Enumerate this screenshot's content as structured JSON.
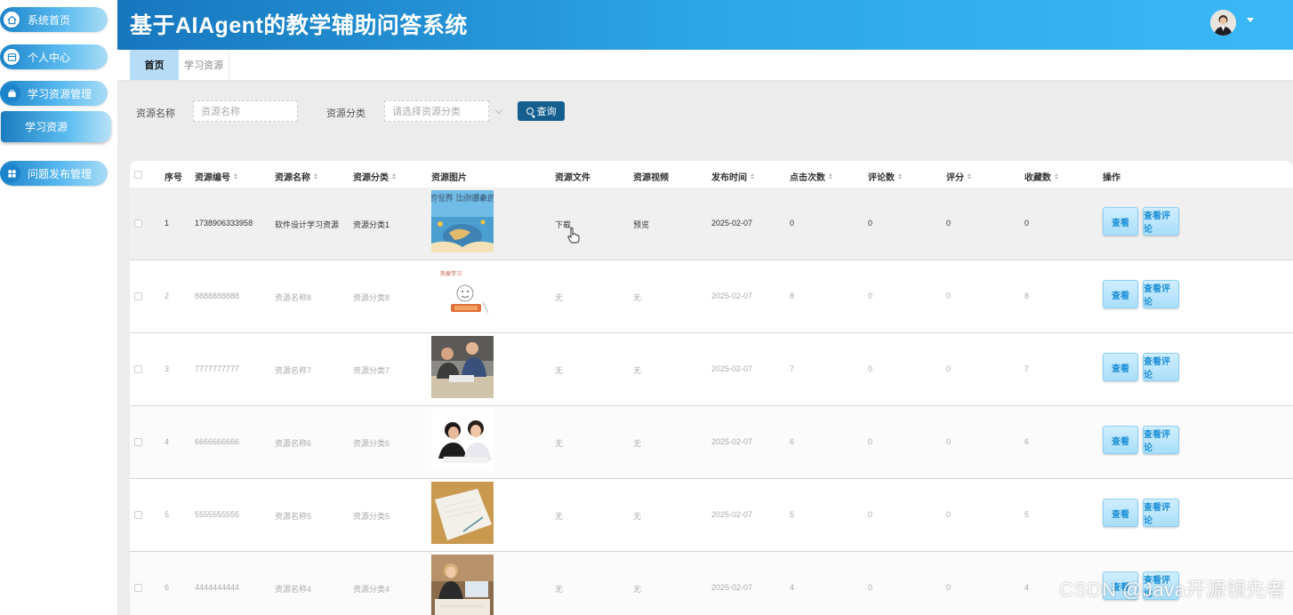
{
  "header": {
    "title": "基于AIAgent的教学辅助问答系统"
  },
  "sidebar": {
    "items": [
      {
        "label": "系统首页",
        "icon": "home-icon"
      },
      {
        "label": "个人中心",
        "icon": "card-icon"
      },
      {
        "label": "学习资源管理",
        "icon": "briefcase-icon"
      },
      {
        "label": "问题发布管理",
        "icon": "grid-icon"
      }
    ],
    "sub_items": [
      {
        "label": "学习资源"
      }
    ]
  },
  "tabs": [
    {
      "label": "首页",
      "active": true
    },
    {
      "label": "学习资源",
      "active": false
    }
  ],
  "search": {
    "name_label": "资源名称",
    "name_placeholder": "资源名称",
    "category_label": "资源分类",
    "category_placeholder": "请选择资源分类",
    "query_button": "查询"
  },
  "table": {
    "headers": [
      "序号",
      "资源编号",
      "资源名称",
      "资源分类",
      "资源图片",
      "资源文件",
      "资源视频",
      "发布时间",
      "点击次数",
      "评论数",
      "评分",
      "收藏数",
      "操作"
    ],
    "rows": [
      {
        "index": "1",
        "code": "1738906333958",
        "name": "软件设计学习资源",
        "category": "资源分类1",
        "file": "下载",
        "video": "预览",
        "date": "2025-02-07",
        "clicks": "0",
        "comments": "0",
        "rating": "0",
        "favorites": "0",
        "view": "查看",
        "comment_btn": "查看评论",
        "image_text": "节国的世界 比你想象的更大"
      },
      {
        "index": "2",
        "code": "8888888888",
        "name": "资源名称8",
        "category": "资源分类8",
        "file": "无",
        "video": "无",
        "date": "2025-02-07",
        "clicks": "8",
        "comments": "0",
        "rating": "0",
        "favorites": "8",
        "view": "查看",
        "comment_btn": "查看评论",
        "image_text": "热爱学习"
      },
      {
        "index": "3",
        "code": "7777777777",
        "name": "资源名称7",
        "category": "资源分类7",
        "file": "无",
        "video": "无",
        "date": "2025-02-07",
        "clicks": "7",
        "comments": "0",
        "rating": "0",
        "favorites": "7",
        "view": "查看",
        "comment_btn": "查看评论"
      },
      {
        "index": "4",
        "code": "6666666666",
        "name": "资源名称6",
        "category": "资源分类6",
        "file": "无",
        "video": "无",
        "date": "2025-02-07",
        "clicks": "6",
        "comments": "0",
        "rating": "0",
        "favorites": "6",
        "view": "查看",
        "comment_btn": "查看评论"
      },
      {
        "index": "5",
        "code": "5555555555",
        "name": "资源名称5",
        "category": "资源分类5",
        "file": "无",
        "video": "无",
        "date": "2025-02-07",
        "clicks": "5",
        "comments": "0",
        "rating": "0",
        "favorites": "5",
        "view": "查看",
        "comment_btn": "查看评论"
      },
      {
        "index": "6",
        "code": "4444444444",
        "name": "资源名称4",
        "category": "资源分类4",
        "file": "无",
        "video": "无",
        "date": "2025-02-07",
        "clicks": "4",
        "comments": "0",
        "rating": "0",
        "favorites": "4",
        "view": "查看",
        "comment_btn": "查看评论"
      }
    ]
  },
  "watermark": "CSDN @Java开源领先者"
}
